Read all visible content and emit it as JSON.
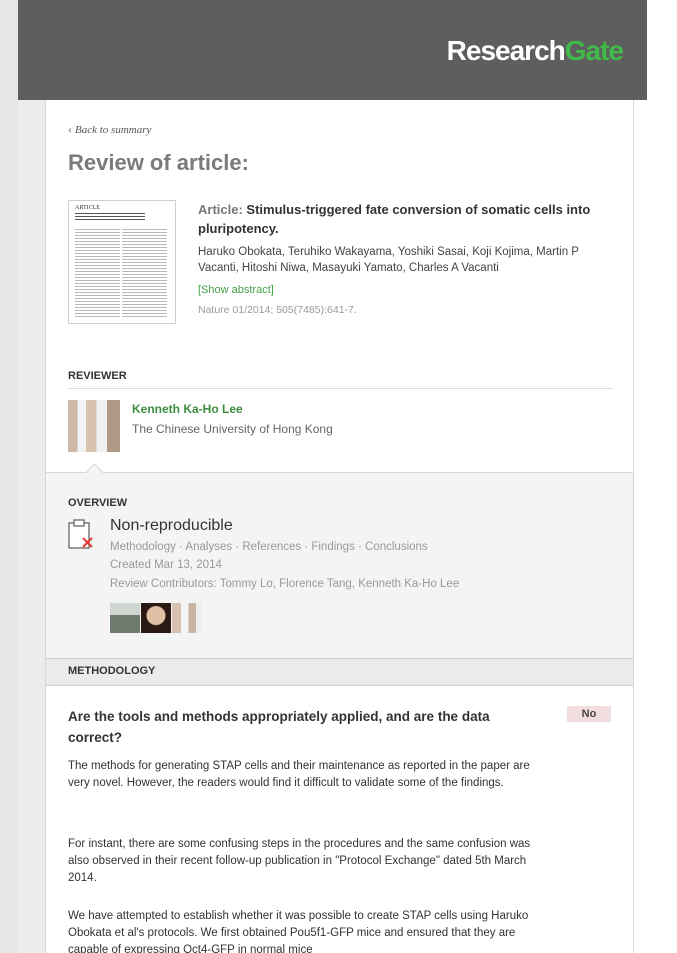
{
  "brand": {
    "research": "Research",
    "gate": "Gate"
  },
  "nav": {
    "back": "Back to summary"
  },
  "page": {
    "title": "Review of article:"
  },
  "article": {
    "label": "Article:",
    "title": "Stimulus-triggered fate conversion of somatic cells into pluripotency.",
    "authors": "Haruko Obokata, Teruhiko Wakayama, Yoshiki Sasai, Koji Kojima, Martin P Vacanti, Hitoshi Niwa, Masayuki Yamato, Charles A Vacanti",
    "show_abstract": "[Show abstract]",
    "journal": "Nature 01/2014; 505(7485):641-7.",
    "thumb_header": "ARTICLE"
  },
  "reviewer": {
    "section_label": "REVIEWER",
    "name": "Kenneth Ka-Ho Lee",
    "affiliation": "The Chinese University of Hong Kong"
  },
  "overview": {
    "section_label": "OVERVIEW",
    "verdict": "Non-reproducible",
    "categories": "Methodology · Analyses · References · Findings · Conclusions",
    "created": "Created Mar 13, 2014",
    "contributors": "Review Contributors: Tommy Lo, Florence Tang, Kenneth Ka-Ho Lee"
  },
  "methodology": {
    "section_label": "METHODOLOGY",
    "question": "Are the tools and methods appropriately applied, and are the data correct?",
    "answer": "No",
    "paragraphs": [
      "The methods for generating STAP cells and their maintenance as reported in the paper are very novel. However, the readers would find it difficult to validate some of the findings.",
      "For instant, there are some confusing steps in the procedures and the same confusion was also observed in their recent follow-up publication in \"Protocol Exchange\" dated 5th March 2014.",
      "We have attempted to establish whether it was possible to create STAP cells using Haruko Obokata et al's protocols. We first obtained Pou5f1-GFP mice and ensured that they are capable of expressing Oct4-GFP in normal mice"
    ]
  },
  "colors": {
    "header": "#5e5e5e",
    "brand_green": "#40ba49",
    "name_green": "#3b8e3f",
    "badge_bg": "#f2dede"
  }
}
